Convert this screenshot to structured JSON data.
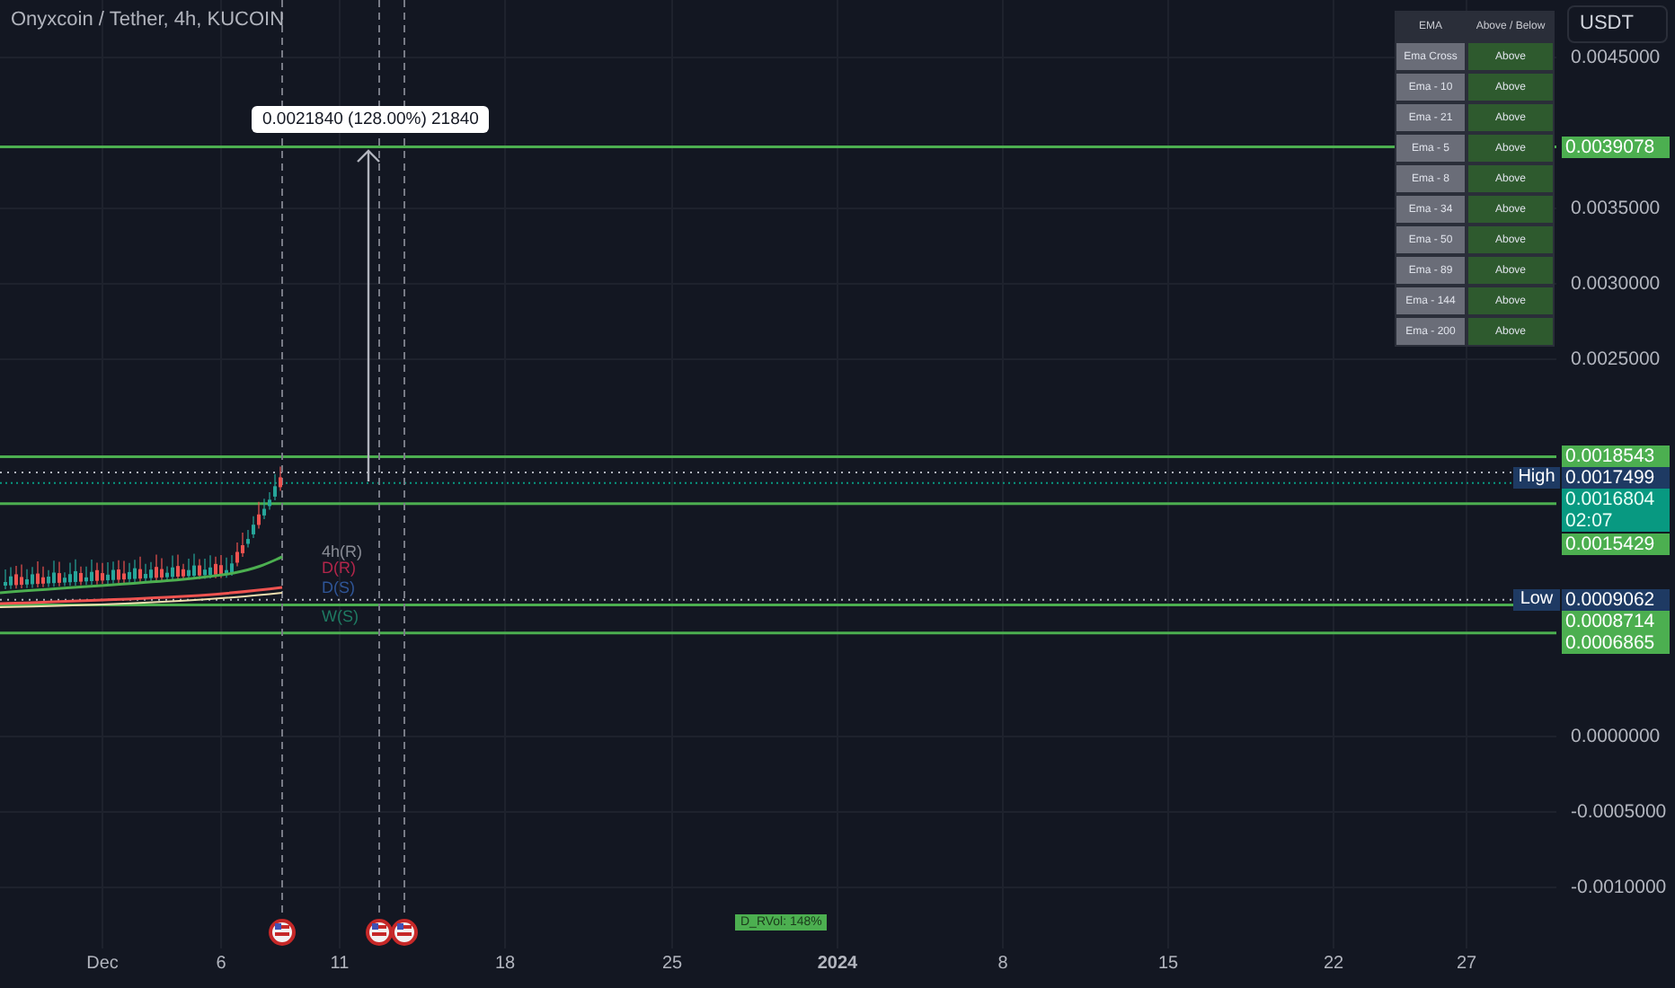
{
  "title": "Onyxcoin / Tether, 4h, KUCOIN",
  "currency": "USDT",
  "ema_table": {
    "columns": [
      "EMA",
      "Above / Below"
    ],
    "rows": [
      {
        "name": "Ema Cross",
        "value": "Above"
      },
      {
        "name": "Ema - 10",
        "value": "Above"
      },
      {
        "name": "Ema - 21",
        "value": "Above"
      },
      {
        "name": "Ema - 5",
        "value": "Above"
      },
      {
        "name": "Ema - 8",
        "value": "Above"
      },
      {
        "name": "Ema - 34",
        "value": "Above"
      },
      {
        "name": "Ema - 50",
        "value": "Above"
      },
      {
        "name": "Ema - 89",
        "value": "Above"
      },
      {
        "name": "Ema - 144",
        "value": "Above"
      },
      {
        "name": "Ema - 200",
        "value": "Above"
      }
    ]
  },
  "measure": {
    "label": "0.0021840 (128.00%) 21840"
  },
  "price_axis": {
    "ticks": [
      "0.0045000",
      "0.0035000",
      "0.0030000",
      "0.0025000",
      "0.0000000",
      "-0.0005000",
      "-0.0010000"
    ]
  },
  "price_labels": [
    {
      "kind": "level",
      "price": "0.0039078"
    },
    {
      "kind": "level",
      "price": "0.0018543"
    },
    {
      "kind": "high",
      "tag": "High",
      "price": "0.0017499"
    },
    {
      "kind": "last",
      "price": "0.0016804",
      "countdown": "02:07"
    },
    {
      "kind": "level",
      "price": "0.0015429"
    },
    {
      "kind": "low",
      "tag": "Low",
      "price": "0.0009062"
    },
    {
      "kind": "level",
      "price": "0.0008714"
    },
    {
      "kind": "level",
      "price": "0.0006865"
    }
  ],
  "pivot_labels": [
    {
      "text": "4h(R)",
      "color": "#8a8d96"
    },
    {
      "text": "D(R)",
      "color": "#b3264b"
    },
    {
      "text": "D(S)",
      "color": "#2f5597"
    },
    {
      "text": "W(S)",
      "color": "#1f7a62"
    }
  ],
  "volatility_badge": "D_RVol: 148%",
  "time_axis": {
    "labels": [
      {
        "text": "Dec",
        "bold": false
      },
      {
        "text": "6",
        "bold": false
      },
      {
        "text": "11",
        "bold": false
      },
      {
        "text": "18",
        "bold": false
      },
      {
        "text": "25",
        "bold": false
      },
      {
        "text": "2024",
        "bold": true
      },
      {
        "text": "8",
        "bold": false
      },
      {
        "text": "15",
        "bold": false
      },
      {
        "text": "22",
        "bold": false
      },
      {
        "text": "27",
        "bold": false
      }
    ]
  }
}
